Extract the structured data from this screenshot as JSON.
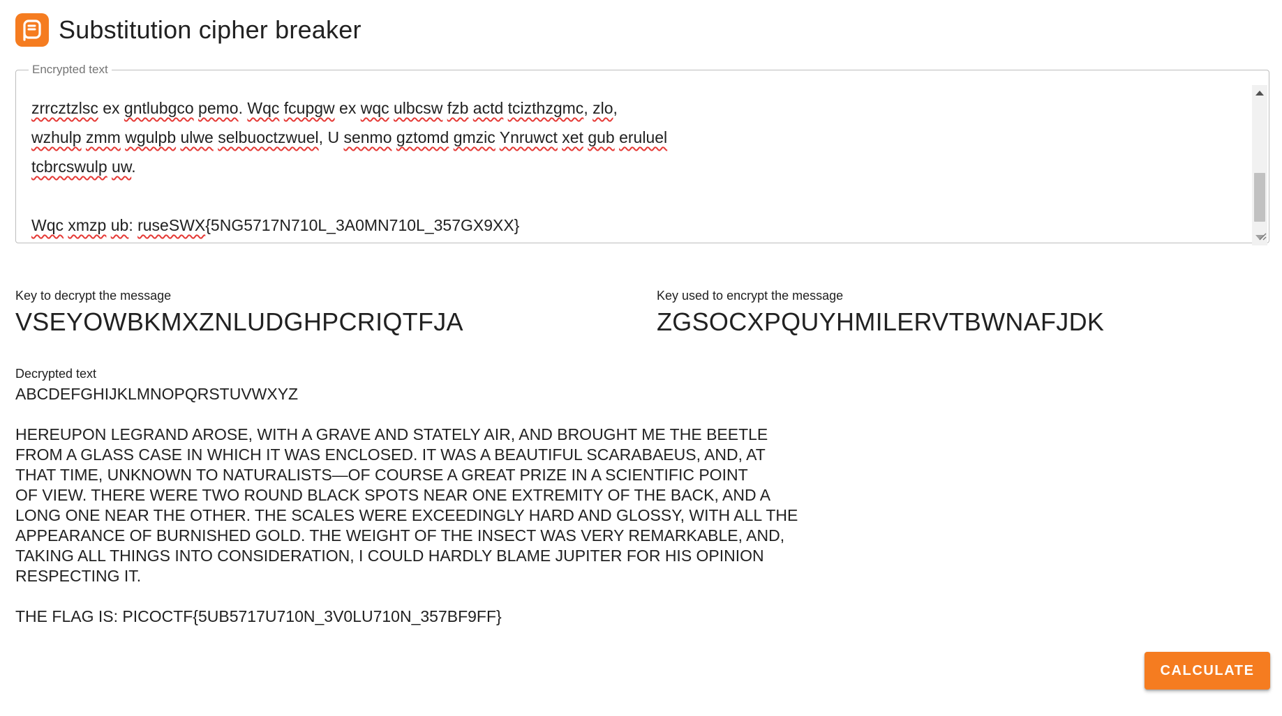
{
  "app": {
    "title": "Substitution cipher breaker",
    "logo_color": "#f57c20",
    "accent_color": "#f57c20"
  },
  "encrypted": {
    "legend": "Encrypted text",
    "lines": [
      [
        {
          "t": "zrrcztzlsc",
          "spell": true
        },
        {
          "t": " ex ",
          "spell": false
        },
        {
          "t": "gntlubgco",
          "spell": true
        },
        {
          "t": " ",
          "spell": false
        },
        {
          "t": "pemo",
          "spell": true
        },
        {
          "t": ". ",
          "spell": false
        },
        {
          "t": "Wqc",
          "spell": true
        },
        {
          "t": " ",
          "spell": false
        },
        {
          "t": "fcupgw",
          "spell": true
        },
        {
          "t": " ex ",
          "spell": false
        },
        {
          "t": "wqc",
          "spell": true
        },
        {
          "t": " ",
          "spell": false
        },
        {
          "t": "ulbcsw",
          "spell": true
        },
        {
          "t": " ",
          "spell": false
        },
        {
          "t": "fzb",
          "spell": true
        },
        {
          "t": " ",
          "spell": false
        },
        {
          "t": "actd",
          "spell": true
        },
        {
          "t": " ",
          "spell": false
        },
        {
          "t": "tcizthzgmc",
          "spell": true
        },
        {
          "t": ", ",
          "spell": false
        },
        {
          "t": "zlo",
          "spell": true
        },
        {
          "t": ",",
          "spell": false
        }
      ],
      [
        {
          "t": "wzhulp",
          "spell": true
        },
        {
          "t": " ",
          "spell": false
        },
        {
          "t": "zmm",
          "spell": true
        },
        {
          "t": " ",
          "spell": false
        },
        {
          "t": "wgulpb",
          "spell": true
        },
        {
          "t": " ",
          "spell": false
        },
        {
          "t": "ulwe",
          "spell": true
        },
        {
          "t": " ",
          "spell": false
        },
        {
          "t": "selbuoctzwuel",
          "spell": true
        },
        {
          "t": ", U ",
          "spell": false
        },
        {
          "t": "senmo",
          "spell": true
        },
        {
          "t": " ",
          "spell": false
        },
        {
          "t": "gztomd",
          "spell": true
        },
        {
          "t": " ",
          "spell": false
        },
        {
          "t": "gmzic",
          "spell": true
        },
        {
          "t": " ",
          "spell": false
        },
        {
          "t": "Ynruwct",
          "spell": true
        },
        {
          "t": " ",
          "spell": false
        },
        {
          "t": "xet",
          "spell": true
        },
        {
          "t": " ",
          "spell": false
        },
        {
          "t": "gub",
          "spell": true
        },
        {
          "t": " ",
          "spell": false
        },
        {
          "t": "eruluel",
          "spell": true
        }
      ],
      [
        {
          "t": "tcbrcswulp",
          "spell": true
        },
        {
          "t": " ",
          "spell": false
        },
        {
          "t": "uw",
          "spell": true
        },
        {
          "t": ".",
          "spell": false
        }
      ],
      [],
      [
        {
          "t": "Wqc",
          "spell": true
        },
        {
          "t": " ",
          "spell": false
        },
        {
          "t": "xmzp",
          "spell": true
        },
        {
          "t": " ",
          "spell": false
        },
        {
          "t": "ub",
          "spell": true
        },
        {
          "t": ": ",
          "spell": false
        },
        {
          "t": "ruseSWX",
          "spell": true
        },
        {
          "t": "{5NG5717N710L_3A0MN710L_357GX9XX}",
          "spell": false
        }
      ]
    ],
    "scroll_fraction": 0.9
  },
  "decrypt_key": {
    "label": "Key to decrypt the message",
    "value": "VSEYOWBKMXZNLUDGHPCRIQTFJA"
  },
  "encrypt_key": {
    "label": "Key used to encrypt the message",
    "value": "ZGSOCXPQUYHMILERVTBWNAFJDK"
  },
  "decrypted": {
    "label": "Decrypted text",
    "lines": [
      "ABCDEFGHIJKLMNOPQRSTUVWXYZ",
      "",
      "HEREUPON LEGRAND AROSE, WITH A GRAVE AND STATELY AIR, AND BROUGHT ME THE BEETLE",
      "FROM A GLASS CASE IN WHICH IT WAS ENCLOSED. IT WAS A BEAUTIFUL SCARABAEUS, AND, AT",
      "THAT TIME, UNKNOWN TO NATURALISTS—OF COURSE A GREAT PRIZE IN A SCIENTIFIC POINT",
      "OF VIEW. THERE WERE TWO ROUND BLACK SPOTS NEAR ONE EXTREMITY OF THE BACK, AND A",
      "LONG ONE NEAR THE OTHER. THE SCALES WERE EXCEEDINGLY HARD AND GLOSSY, WITH ALL THE",
      "APPEARANCE OF BURNISHED GOLD. THE WEIGHT OF THE INSECT WAS VERY REMARKABLE, AND,",
      "TAKING ALL THINGS INTO CONSIDERATION, I COULD HARDLY BLAME JUPITER FOR HIS OPINION",
      "RESPECTING IT.",
      "",
      "THE FLAG IS: PICOCTF{5UB5717U710N_3V0LU710N_357BF9FF}"
    ]
  },
  "calculate_button": {
    "label": "CALCULATE"
  }
}
